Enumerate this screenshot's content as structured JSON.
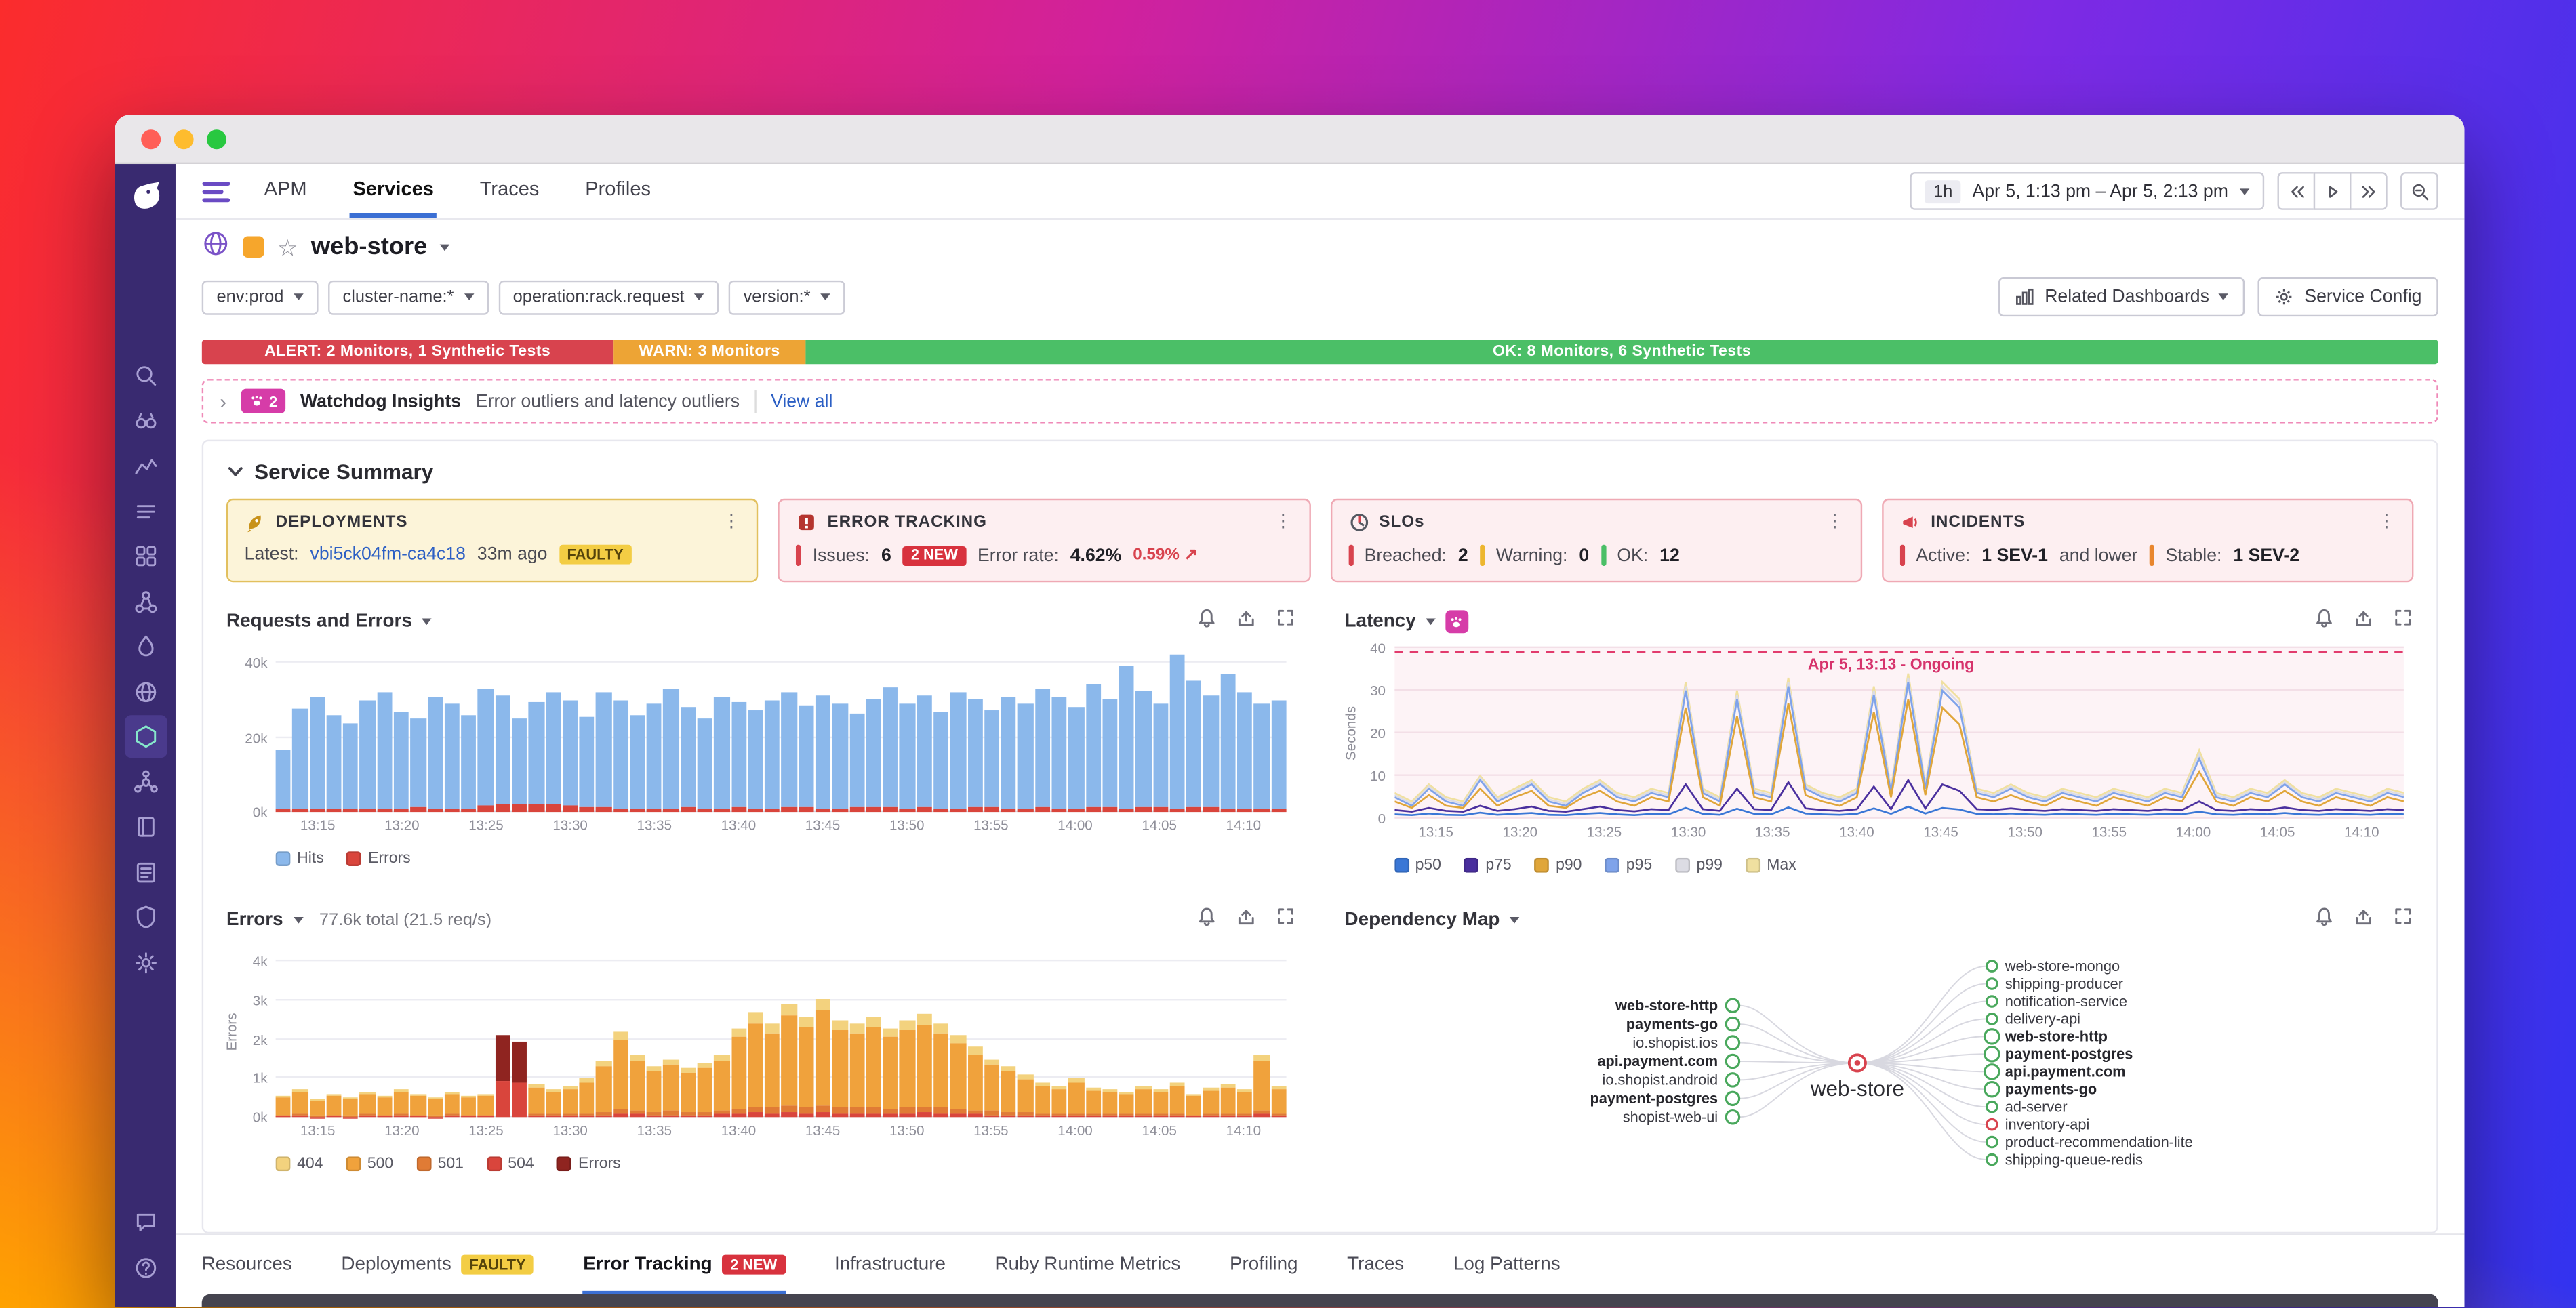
{
  "colors": {
    "brand_purple": "#392a70",
    "link_blue": "#2c5fc4",
    "alert_red": "#d8434e",
    "warn_orange": "#eda435",
    "ok_green": "#4bbf67",
    "watchdog_pink": "#d63ca8",
    "active_tab_blue": "#3b6fd4"
  },
  "sidebar": {
    "icons": [
      {
        "name": "search"
      },
      {
        "name": "watchdog"
      },
      {
        "name": "metrics"
      },
      {
        "name": "events"
      },
      {
        "name": "infrastructure"
      },
      {
        "name": "network"
      },
      {
        "name": "apm"
      },
      {
        "name": "synthetics"
      },
      {
        "name": "services",
        "active": true
      },
      {
        "name": "service-map"
      },
      {
        "name": "notebooks"
      },
      {
        "name": "logs"
      },
      {
        "name": "security"
      },
      {
        "name": "settings"
      }
    ],
    "bottom_icons": [
      {
        "name": "chat"
      },
      {
        "name": "help"
      }
    ]
  },
  "topnav": {
    "tabs": [
      {
        "label": "APM",
        "active": false
      },
      {
        "label": "Services",
        "active": true
      },
      {
        "label": "Traces",
        "active": false
      },
      {
        "label": "Profiles",
        "active": false
      }
    ],
    "time": {
      "preset": "1h",
      "range": "Apr 5, 1:13 pm – Apr 5, 2:13 pm"
    }
  },
  "service_header": {
    "name": "web-store"
  },
  "filters": [
    {
      "label": "env:prod"
    },
    {
      "label": "cluster-name:*"
    },
    {
      "label": "operation:rack.request"
    },
    {
      "label": "version:*"
    }
  ],
  "header_actions": {
    "related_dashboards": "Related Dashboards",
    "service_config": "Service Config"
  },
  "monitor_bar": {
    "alert": "ALERT: 2 Monitors, 1 Synthetic Tests",
    "warn": "WARN: 3 Monitors",
    "ok": "OK: 8 Monitors, 6 Synthetic Tests"
  },
  "watchdog_insights": {
    "count": "2",
    "title": "Watchdog Insights",
    "description": "Error outliers and latency outliers",
    "link": "View all"
  },
  "service_summary": {
    "title": "Service Summary",
    "deployments": {
      "title": "DEPLOYMENTS",
      "latest_label": "Latest:",
      "version": "vbi5ck04fm-ca4c18",
      "age": "33m ago",
      "badge": "FAULTY"
    },
    "error_tracking": {
      "title": "ERROR TRACKING",
      "issues_label": "Issues:",
      "issues": "6",
      "new_badge": "2 NEW",
      "rate_label": "Error rate:",
      "rate": "4.62%",
      "delta": "0.59%",
      "delta_arrow": "↗"
    },
    "slos": {
      "title": "SLOs",
      "breached_label": "Breached:",
      "breached": "2",
      "warning_label": "Warning:",
      "warning": "0",
      "ok_label": "OK:",
      "ok": "12"
    },
    "incidents": {
      "title": "INCIDENTS",
      "active_label": "Active:",
      "active": "1 SEV-1",
      "active_suffix": "and lower",
      "stable_label": "Stable:",
      "stable": "1 SEV-2"
    }
  },
  "chart_data": {
    "requests": {
      "type": "bar",
      "title": "Requests and Errors",
      "x_start": "13:13",
      "x_ticks": [
        "13:15",
        "13:20",
        "13:25",
        "13:30",
        "13:35",
        "13:40",
        "13:45",
        "13:50",
        "13:55",
        "14:00",
        "14:05",
        "14:10"
      ],
      "ylim": [
        0,
        44
      ],
      "unit": "thousands",
      "y_ticks": [
        {
          "v": 0,
          "label": "0k"
        },
        {
          "v": 20,
          "label": "20k"
        },
        {
          "v": 40,
          "label": "40k"
        }
      ],
      "legend": [
        {
          "label": "Hits",
          "color": "#8bb8eb"
        },
        {
          "label": "Errors",
          "color": "#d9453c"
        }
      ],
      "series": [
        {
          "name": "Hits",
          "values": [
            16,
            27,
            30,
            25,
            23,
            29,
            31,
            26,
            24,
            30,
            28,
            25,
            31,
            29,
            23,
            27,
            30,
            28,
            24,
            31,
            29,
            25,
            28,
            32,
            27,
            24,
            30,
            28,
            26,
            29,
            31,
            27,
            30,
            28,
            25,
            29,
            32,
            28,
            30,
            26,
            31,
            29,
            26,
            30,
            28,
            32,
            30,
            27,
            33,
            29,
            38,
            31,
            28,
            41,
            34,
            30,
            36,
            31,
            28,
            29
          ]
        },
        {
          "name": "Errors",
          "values": [
            0.7,
            0.9,
            1.0,
            0.8,
            0.9,
            1.1,
            1.0,
            0.9,
            1.2,
            1.0,
            0.9,
            1.1,
            1.9,
            2.3,
            2.1,
            2.4,
            2.0,
            1.8,
            1.5,
            1.2,
            1.0,
            1.1,
            0.9,
            1.0,
            1.2,
            1.1,
            1.0,
            1.3,
            1.1,
            1.0,
            1.2,
            1.4,
            1.1,
            1.0,
            1.2,
            1.5,
            1.3,
            1.1,
            1.2,
            1.0,
            1.1,
            1.3,
            1.2,
            1.0,
            1.1,
            1.2,
            1.0,
            1.1,
            1.3,
            1.2,
            1.1,
            1.4,
            1.2,
            1.1,
            1.3,
            1.2,
            1.0,
            1.1,
            0.9,
            1.0
          ]
        }
      ]
    },
    "latency": {
      "type": "line",
      "title": "Latency",
      "ylabel": "Seconds",
      "ylim": [
        0,
        40
      ],
      "y_ticks": [
        0,
        10,
        20,
        30,
        40
      ],
      "x_ticks": [
        "13:15",
        "13:20",
        "13:25",
        "13:30",
        "13:35",
        "13:40",
        "13:45",
        "13:50",
        "13:55",
        "14:00",
        "14:05",
        "14:10"
      ],
      "annotation": {
        "text": "Apr 5, 13:13 - Ongoing",
        "color": "#d6336c"
      },
      "series": [
        {
          "name": "p50",
          "color": "#3a77d6",
          "values": [
            1,
            0.8,
            1.2,
            0.9,
            0.8,
            1.4,
            0.9,
            1.1,
            1.3,
            0.9,
            0.8,
            1.1,
            1.3,
            1,
            0.8,
            1.1,
            1,
            2.5,
            1.1,
            0.9,
            2.3,
            1.1,
            1,
            2.6,
            1.2,
            1,
            0.9,
            1.1,
            2.4,
            1.1,
            2.8,
            1.2,
            2.5,
            2.1,
            1.1,
            1,
            1.2,
            1,
            0.9,
            1.1,
            1,
            0.9,
            1.1,
            1,
            0.9,
            1.1,
            1,
            1.6,
            1,
            0.9,
            1.1,
            1,
            1.3,
            1,
            0.9,
            1.1,
            1,
            0.9,
            1.1,
            1
          ]
        },
        {
          "name": "p75",
          "color": "#4a2f9e",
          "values": [
            2,
            1.6,
            2.5,
            1.8,
            1.6,
            3,
            1.8,
            2.2,
            2.8,
            1.8,
            1.6,
            2.2,
            2.8,
            2,
            1.7,
            2.2,
            2,
            8,
            2.2,
            1.8,
            7,
            2.2,
            2,
            8.5,
            2.4,
            2,
            1.8,
            2.2,
            7.5,
            2.2,
            9,
            2.4,
            8,
            6.5,
            2.2,
            2,
            2.4,
            2,
            1.8,
            2.2,
            2,
            1.8,
            2.2,
            2,
            1.8,
            2.2,
            2,
            4,
            2,
            1.8,
            2.2,
            2,
            2.6,
            2,
            1.8,
            2.2,
            2,
            1.8,
            2.2,
            2
          ]
        },
        {
          "name": "p90",
          "color": "#e0a63a",
          "values": [
            4,
            2.5,
            5.5,
            3,
            2.5,
            7,
            3,
            5,
            6.5,
            3,
            2.5,
            5,
            6.5,
            4,
            3,
            5,
            4,
            26,
            5,
            3,
            24,
            5,
            4,
            27,
            5.5,
            4,
            3,
            5,
            25,
            5,
            28,
            5.5,
            26,
            22,
            5,
            4,
            5.5,
            4,
            3,
            5,
            4,
            3,
            5,
            4,
            3,
            5,
            4,
            11,
            4,
            3,
            5,
            4,
            6.5,
            4,
            3,
            5,
            4,
            3,
            5,
            4
          ]
        },
        {
          "name": "p95",
          "color": "#7fa3ea",
          "values": [
            5,
            3,
            7,
            4,
            3,
            9,
            4,
            6,
            8,
            4,
            3,
            6,
            8,
            5,
            4,
            6,
            5,
            30,
            6,
            4,
            28,
            6,
            5,
            31,
            7,
            5,
            4,
            6,
            29,
            6,
            32,
            7,
            30,
            26,
            6,
            5,
            7,
            5,
            4,
            6,
            5,
            4,
            6,
            5,
            4,
            6,
            5,
            14,
            5,
            4,
            6,
            5,
            8,
            5,
            4,
            6,
            5,
            4,
            6,
            5
          ]
        },
        {
          "name": "p99",
          "color": "#dcdce4",
          "values": [
            5.5,
            3.5,
            7.5,
            4.5,
            3.5,
            9.5,
            4.5,
            6.5,
            8.5,
            4.5,
            3.5,
            6.5,
            8.5,
            5.5,
            4.5,
            6.5,
            5.5,
            31,
            6.5,
            4.5,
            29,
            6.5,
            5.5,
            32,
            7.5,
            5.5,
            4.5,
            6.5,
            30,
            6.5,
            33,
            7.5,
            31,
            27,
            6.5,
            5.5,
            7.5,
            5.5,
            4.5,
            6.5,
            5.5,
            4.5,
            6.5,
            5.5,
            4.5,
            6.5,
            5.5,
            15,
            5.5,
            4.5,
            6.5,
            5.5,
            8.5,
            5.5,
            4.5,
            6.5,
            5.5,
            4.5,
            6.5,
            5.5
          ]
        },
        {
          "name": "Max",
          "color": "#f0e0a0",
          "values": [
            6,
            4,
            8,
            5,
            4,
            10,
            5,
            7,
            9,
            5,
            4,
            7,
            9,
            6,
            5,
            7,
            6,
            32,
            7,
            5,
            30,
            7,
            6,
            33,
            8,
            6,
            5,
            7,
            31,
            7,
            34,
            8,
            32,
            28,
            7,
            6,
            8,
            6,
            5,
            7,
            6,
            5,
            7,
            6,
            5,
            7,
            6,
            16,
            6,
            5,
            7,
            6,
            9,
            6,
            5,
            7,
            6,
            5,
            7,
            6
          ]
        }
      ]
    },
    "errors": {
      "type": "bar",
      "title": "Errors",
      "total_label": "77.6k total (21.5 req/s)",
      "ylabel": "Errors",
      "ylim": [
        0,
        4.4
      ],
      "unit": "thousands",
      "y_ticks": [
        {
          "v": 0,
          "label": "0k"
        },
        {
          "v": 1,
          "label": "1k"
        },
        {
          "v": 2,
          "label": "2k"
        },
        {
          "v": 3,
          "label": "3k"
        },
        {
          "v": 4,
          "label": "4k"
        }
      ],
      "x_ticks": [
        "13:15",
        "13:20",
        "13:25",
        "13:30",
        "13:35",
        "13:40",
        "13:45",
        "13:50",
        "13:55",
        "14:00",
        "14:05",
        "14:10"
      ],
      "legend": [
        {
          "label": "404",
          "color": "#f3d27e"
        },
        {
          "label": "500",
          "color": "#f0a23c"
        },
        {
          "label": "501",
          "color": "#e07b35"
        },
        {
          "label": "504",
          "color": "#d9453c"
        },
        {
          "label": "Errors",
          "color": "#8f2420"
        }
      ],
      "values": [
        0.55,
        0.7,
        0.45,
        0.6,
        0.5,
        0.65,
        0.55,
        0.7,
        0.6,
        0.5,
        0.65,
        0.55,
        0.6,
        2.1,
        1.95,
        0.85,
        0.7,
        0.8,
        1.0,
        1.45,
        2.2,
        1.6,
        1.3,
        1.5,
        1.25,
        1.4,
        1.6,
        2.3,
        2.7,
        2.4,
        2.9,
        2.6,
        3.05,
        2.5,
        2.4,
        2.6,
        2.3,
        2.5,
        2.65,
        2.4,
        2.1,
        1.8,
        1.5,
        1.3,
        1.1,
        0.9,
        0.8,
        1.0,
        0.75,
        0.7,
        0.65,
        0.8,
        0.7,
        0.9,
        0.6,
        0.75,
        0.85,
        0.7,
        1.6,
        0.8
      ],
      "hot_indices": [
        13,
        14
      ]
    },
    "dependency_map": {
      "type": "graph",
      "title": "Dependency Map",
      "center": {
        "name": "web-store",
        "status": "alert"
      },
      "left_nodes": [
        {
          "name": "web-store-http",
          "bold": true
        },
        {
          "name": "payments-go",
          "bold": true
        },
        {
          "name": "io.shopist.ios"
        },
        {
          "name": "api.payment.com",
          "bold": true
        },
        {
          "name": "io.shopist.android"
        },
        {
          "name": "payment-postgres",
          "bold": true
        },
        {
          "name": "shopist-web-ui"
        }
      ],
      "right_nodes": [
        {
          "name": "web-store-mongo"
        },
        {
          "name": "shipping-producer"
        },
        {
          "name": "notification-service"
        },
        {
          "name": "delivery-api"
        },
        {
          "name": "web-store-http",
          "bold": true
        },
        {
          "name": "payment-postgres",
          "bold": true
        },
        {
          "name": "api.payment.com",
          "bold": true
        },
        {
          "name": "payments-go",
          "bold": true
        },
        {
          "name": "ad-server"
        },
        {
          "name": "inventory-api",
          "status": "alert"
        },
        {
          "name": "product-recommendation-lite"
        },
        {
          "name": "shipping-queue-redis"
        }
      ]
    }
  },
  "footer_tabs": [
    {
      "label": "Resources"
    },
    {
      "label": "Deployments",
      "badge": "FAULTY",
      "badge_type": "warn"
    },
    {
      "label": "Error Tracking",
      "badge": "2 NEW",
      "badge_type": "alert",
      "active": true
    },
    {
      "label": "Infrastructure"
    },
    {
      "label": "Ruby Runtime Metrics"
    },
    {
      "label": "Profiling"
    },
    {
      "label": "Traces"
    },
    {
      "label": "Log Patterns"
    }
  ]
}
